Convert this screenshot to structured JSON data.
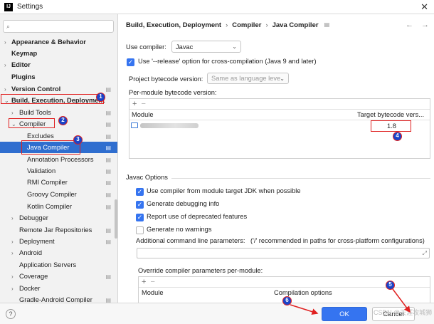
{
  "window": {
    "title": "Settings",
    "app_icon": "IJ"
  },
  "search": {
    "placeholder": "",
    "icon": "search-icon"
  },
  "sidebar": {
    "items": [
      {
        "label": "Appearance & Behavior",
        "arrow": "›"
      },
      {
        "label": "Keymap"
      },
      {
        "label": "Editor",
        "arrow": "›"
      },
      {
        "label": "Plugins"
      },
      {
        "label": "Version Control",
        "arrow": "›"
      },
      {
        "label": "Build, Execution, Deployment",
        "arrow": "⌄"
      },
      {
        "label": "Build Tools",
        "arrow": "›"
      },
      {
        "label": "Compiler",
        "arrow": "⌄"
      },
      {
        "label": "Excludes"
      },
      {
        "label": "Java Compiler"
      },
      {
        "label": "Annotation Processors"
      },
      {
        "label": "Validation"
      },
      {
        "label": "RMI Compiler"
      },
      {
        "label": "Groovy Compiler"
      },
      {
        "label": "Kotlin Compiler"
      },
      {
        "label": "Debugger",
        "arrow": "›"
      },
      {
        "label": "Remote Jar Repositories"
      },
      {
        "label": "Deployment",
        "arrow": "›"
      },
      {
        "label": "Android",
        "arrow": "›"
      },
      {
        "label": "Application Servers"
      },
      {
        "label": "Coverage",
        "arrow": "›"
      },
      {
        "label": "Docker",
        "arrow": "›"
      },
      {
        "label": "Gradle-Android Compiler"
      }
    ],
    "settings_glyph": "▤"
  },
  "annotations": {
    "badges": [
      "1",
      "2",
      "3",
      "4",
      "5",
      "6"
    ]
  },
  "breadcrumb": {
    "items": [
      "Build, Execution, Deployment",
      "Compiler",
      "Java Compiler"
    ],
    "separator": "›"
  },
  "nav": {
    "back": "←",
    "forward": "→"
  },
  "compiler": {
    "use_compiler_label": "Use compiler:",
    "use_compiler_value": "Javac",
    "release_option_label": "Use '--release' option for cross-compilation (Java 9 and later)",
    "release_option_checked": true,
    "project_bytecode_label": "Project bytecode version:",
    "project_bytecode_value": "Same as language leve",
    "per_module_label": "Per-module bytecode version:"
  },
  "module_table": {
    "toolbar": [
      "+",
      "−"
    ],
    "columns": [
      "Module",
      "Target bytecode vers..."
    ],
    "rows": [
      {
        "module": "",
        "target": "1.8"
      }
    ]
  },
  "javac_options": {
    "section_title": "Javac Options",
    "options": [
      {
        "label": "Use compiler from module target JDK when possible",
        "checked": true
      },
      {
        "label": "Generate debugging info",
        "checked": true
      },
      {
        "label": "Report use of deprecated features",
        "checked": true
      },
      {
        "label": "Generate no warnings",
        "checked": false
      }
    ],
    "additional_params_label": "Additional command line parameters:",
    "additional_params_hint": "('/' recommended in paths for cross-platform configurations)",
    "additional_params_value": "",
    "override_label": "Override compiler parameters per-module:",
    "override_toolbar": [
      "+",
      "−"
    ],
    "override_columns": [
      "Module",
      "Compilation options"
    ]
  },
  "footer": {
    "help": "?",
    "ok": "OK",
    "cancel": "Cancel"
  },
  "watermark": "CSDN @天涯攻城狮",
  "colors": {
    "accent": "#3574f0",
    "selection": "#2f6ecf",
    "annotation_red": "#e02020",
    "badge_blue": "#1a44c8"
  }
}
